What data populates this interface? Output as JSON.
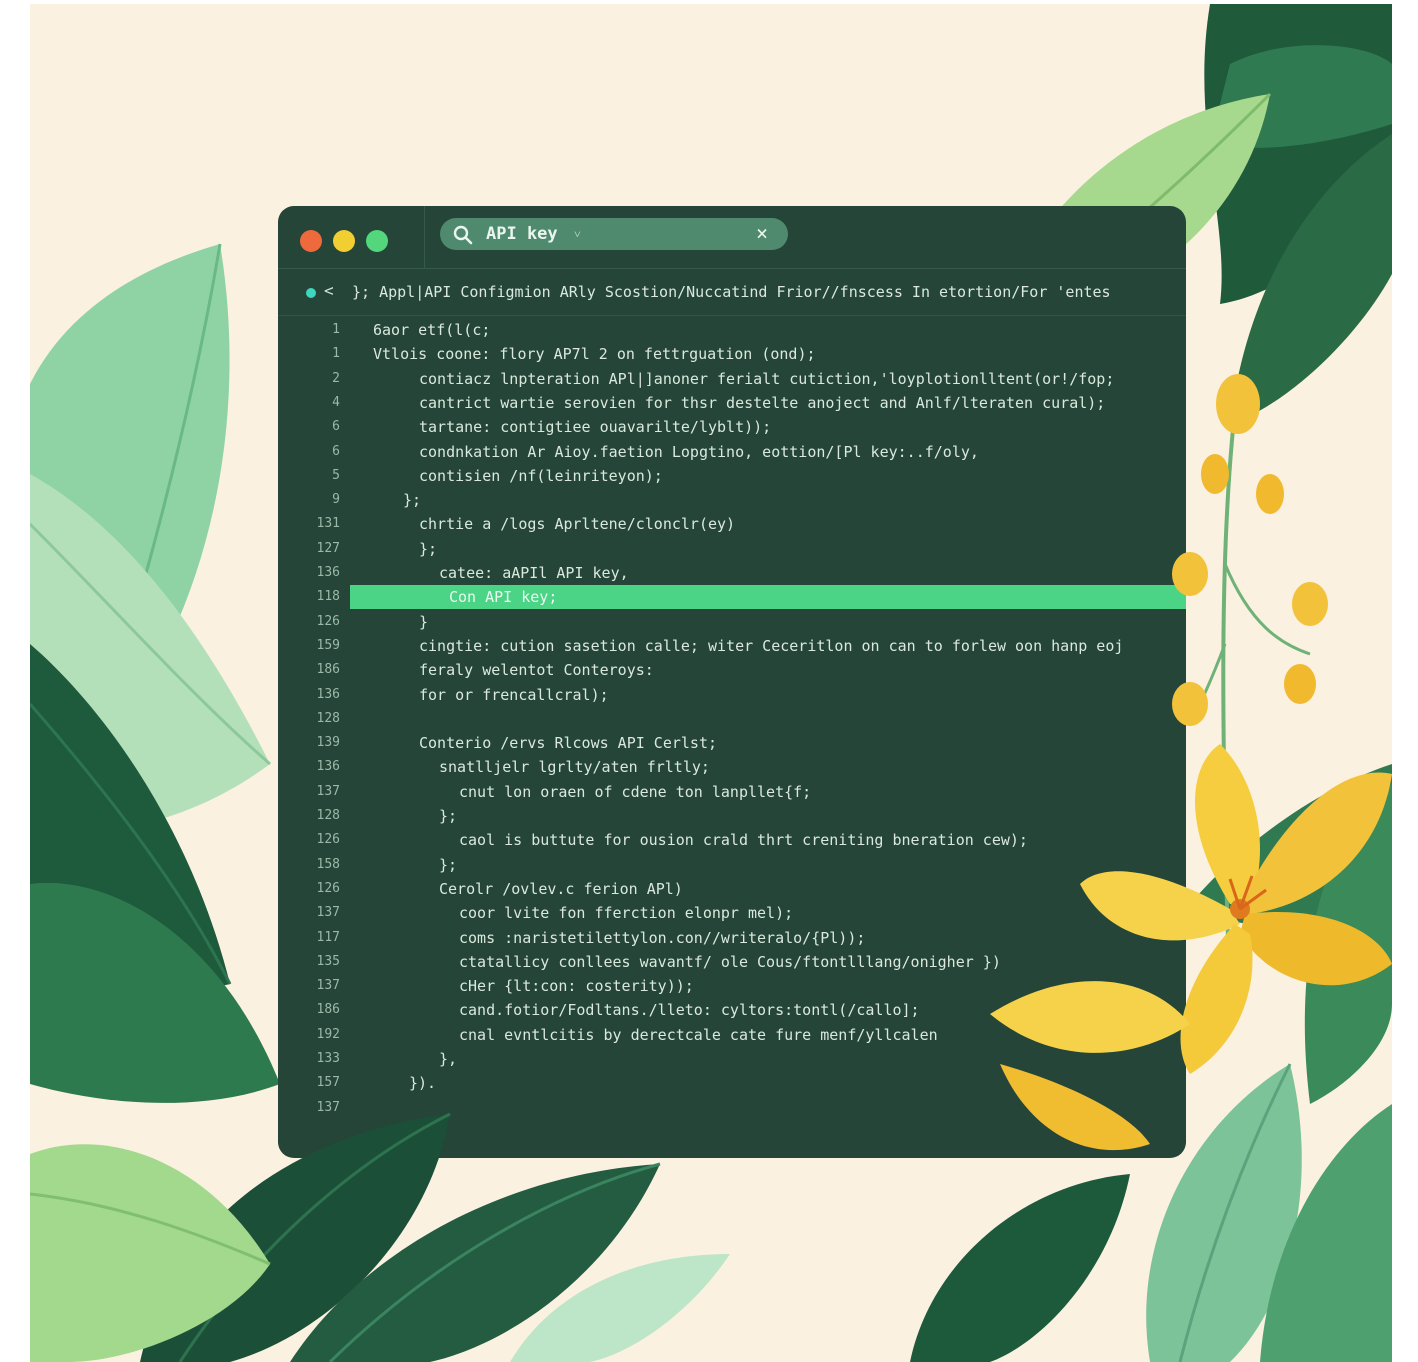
{
  "colors": {
    "background": "#fbf1e1",
    "window": "#244538",
    "highlight": "#4bd485",
    "search_pill": "#4f8a6f",
    "traffic_red": "#ee6a3c",
    "traffic_yellow": "#f1cf33",
    "traffic_green": "#53d67c",
    "keyword_yellow": "#e7d64c",
    "keyword_teal": "#5fd6c9"
  },
  "icons": [
    "search-icon",
    "chevron-down-icon",
    "close-icon",
    "chevron-left-icon",
    "status-dot-icon"
  ],
  "search": {
    "value": "API key",
    "caret": "˅",
    "clear": "×"
  },
  "breadcrumb": {
    "back": "<",
    "path": "}; Appl|API Configmion ARly Scostion/Nuccatind Frior//fnscess In etortion/For 'entes"
  },
  "code_lines": [
    {
      "num": "1",
      "text": "6aor etf(l(c;"
    },
    {
      "num": "1",
      "text": "Vtlois coone: flory AP7l 2 on fettrguation (ond);"
    },
    {
      "num": "2",
      "text": "contiacz lnpteration APl|]anoner ferialt cutiction,'loyplotionlltent(or!/fop;"
    },
    {
      "num": "4",
      "text": "cantrict wartie serovien for thsr destelte anoject and Anlf/lteraten cural);"
    },
    {
      "num": "6",
      "text": "tartane: contigtiee ouavarilte/lyblt));"
    },
    {
      "num": "6",
      "text": "condnkation Ar Aioy.faetion Lopgtino, eottion/[Pl key:..f/oly,"
    },
    {
      "num": "5",
      "text": "contisien /nf(leinriteyon);"
    },
    {
      "num": "9",
      "text": "};"
    },
    {
      "num": "131",
      "text": "chrtie a /logs Aprltene/clonclr(ey)"
    },
    {
      "num": "127",
      "text": "};"
    },
    {
      "num": "136",
      "text": "catee: aAPIl API key,"
    },
    {
      "num": "118",
      "text": "Con API key;"
    },
    {
      "num": "126",
      "text": "}"
    },
    {
      "num": "159",
      "text": "cingtie: cution sasetion calle; witer Ceceritlon on can to forlew oon hanp eoj"
    },
    {
      "num": "186",
      "text": "feraly welentot Conteroys:"
    },
    {
      "num": "136",
      "text": "for or frencallcral);"
    },
    {
      "num": "128",
      "text": ""
    },
    {
      "num": "139",
      "text": "Conterio /ervs Rlcows API Cerlst;"
    },
    {
      "num": "136",
      "text": "snatlljelr lgrlty/aten frltly;"
    },
    {
      "num": "137",
      "text": "cnut lon oraen of cdene ton lanpllet{f;"
    },
    {
      "num": "128",
      "text": "};"
    },
    {
      "num": "126",
      "text": "caol is buttute for ousion crald thrt creniting bneration cew);"
    },
    {
      "num": "158",
      "text": "};"
    },
    {
      "num": "126",
      "text": "Cerolr /ovlev.c ferion APl)"
    },
    {
      "num": "137",
      "text": "coor lvite fon fferction elonpr mel);"
    },
    {
      "num": "117",
      "text": "coms :naristetilettylon.con//writeralo/{Pl));"
    },
    {
      "num": "135",
      "text": "ctatallicy conllees wavantf/ ole Cous/ftontlllang/onigher })"
    },
    {
      "num": "137",
      "text": "cHer {lt:con: costerity));"
    },
    {
      "num": "186",
      "text": "cand.fotior/Fodltans./lleto: cyltors:tontl(/callo];"
    },
    {
      "num": "192",
      "text": "cnal evntlcitis by derectcale cate fure menf/yllcalen"
    },
    {
      "num": "133",
      "text": "},"
    },
    {
      "num": "157",
      "text": "})."
    },
    {
      "num": "137",
      "text": ""
    }
  ]
}
